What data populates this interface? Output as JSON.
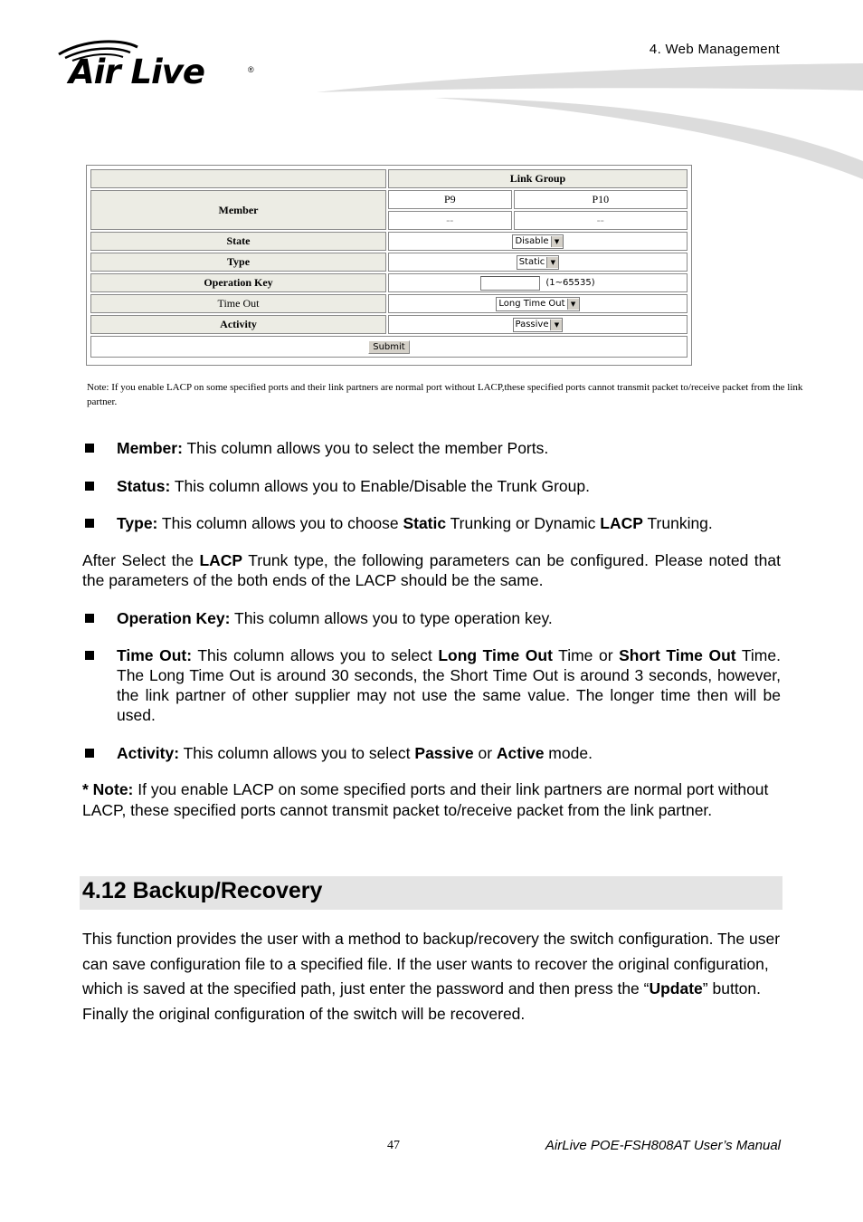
{
  "header": {
    "logo_text": "Air Live",
    "logo_registered": "®",
    "chapter": "4. Web Management"
  },
  "config_table": {
    "title": "Link Group",
    "rows": {
      "member": {
        "label": "Member",
        "ports": [
          "P9",
          "P10"
        ],
        "port_values": [
          "--",
          "--"
        ]
      },
      "state": {
        "label": "State",
        "selected": "Disable"
      },
      "type": {
        "label": "Type",
        "selected": "Static"
      },
      "operation_key": {
        "label": "Operation Key",
        "value": "",
        "range_hint": "(1~65535)"
      },
      "time_out": {
        "label": "Time Out",
        "selected": "Long Time Out"
      },
      "activity": {
        "label": "Activity",
        "selected": "Passive"
      }
    },
    "submit_label": "Submit"
  },
  "small_note": "Note: If you enable LACP on some specified ports and their link partners are normal port without LACP,these specified ports cannot transmit packet to/receive packet from the link partner.",
  "bullets_a": [
    {
      "term": "Member:",
      "text": " This column allows you to select the member Ports."
    },
    {
      "term": "Status:",
      "text": " This column allows you to Enable/Disable the Trunk Group."
    },
    {
      "term": "Type:",
      "text1": " This column allows you to choose ",
      "b1": "Static",
      "text2": " Trunking or Dynamic ",
      "b2": "LACP",
      "text3": " Trunking."
    }
  ],
  "after_para": {
    "t1": "After Select the ",
    "b1": "LACP",
    "t2": " Trunk type, the following parameters can be configured. Please noted that the parameters of the both ends of the LACP should be the same."
  },
  "bullets_b": {
    "operation_key": {
      "term": "Operation Key:",
      "text": " This column allows you to type operation key."
    },
    "time_out": {
      "term": "Time Out:",
      "t1": " This column allows you to select ",
      "b1": "Long Time Out",
      "t2": " Time or ",
      "b2": "Short Time Out",
      "t3": " Time. The Long Time Out is around 30 seconds, the Short Time Out is around 3 seconds, however, the link partner of other supplier may not use the same value. The longer time then will be used."
    },
    "activity": {
      "term": "Activity:",
      "t1": " This column allows you to select ",
      "b1": "Passive",
      "t2": " or ",
      "b2": "Active",
      "t3": " mode."
    }
  },
  "note": {
    "label": "* Note:",
    "text": " If you enable LACP on some specified ports and their link partners are normal port without LACP, these specified ports cannot transmit packet to/receive packet from the link partner."
  },
  "section": {
    "title": "4.12 Backup/Recovery",
    "t1": "This function provides the user with a method to backup/recovery the switch configuration. The user can save configuration file to a specified file. If the user wants to recover the original configuration, which is saved at the specified path, just enter the password and then press the “",
    "b1": "Update",
    "t2": "” button. Finally the original configuration of the switch will be recovered."
  },
  "footer": {
    "page_number": "47",
    "manual_title": "AirLive POE-FSH808AT User’s Manual"
  }
}
